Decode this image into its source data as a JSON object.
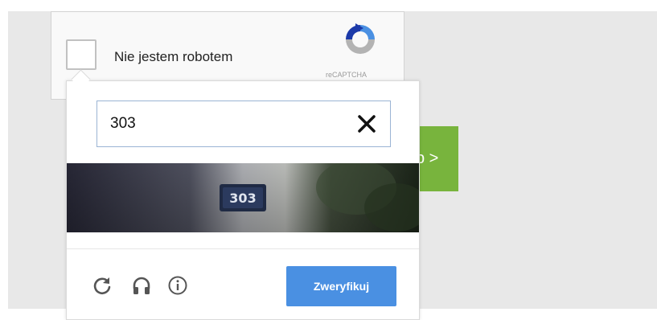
{
  "anchor": {
    "checkbox_label": "Nie jestem robotem",
    "brand_text": "reCAPTCHA",
    "logo_icon": "recaptcha-logo-icon"
  },
  "background_button": {
    "label": "p >"
  },
  "challenge": {
    "answer_value": "303",
    "clear_icon": "close-icon",
    "image_house_number": "303",
    "reload_icon": "reload-icon",
    "audio_icon": "headphones-icon",
    "info_icon": "info-icon",
    "verify_label": "Zweryfikuj"
  },
  "colors": {
    "verify_button": "#4a90e2",
    "next_button": "#78b43d",
    "page_background": "#e8e8e8"
  }
}
